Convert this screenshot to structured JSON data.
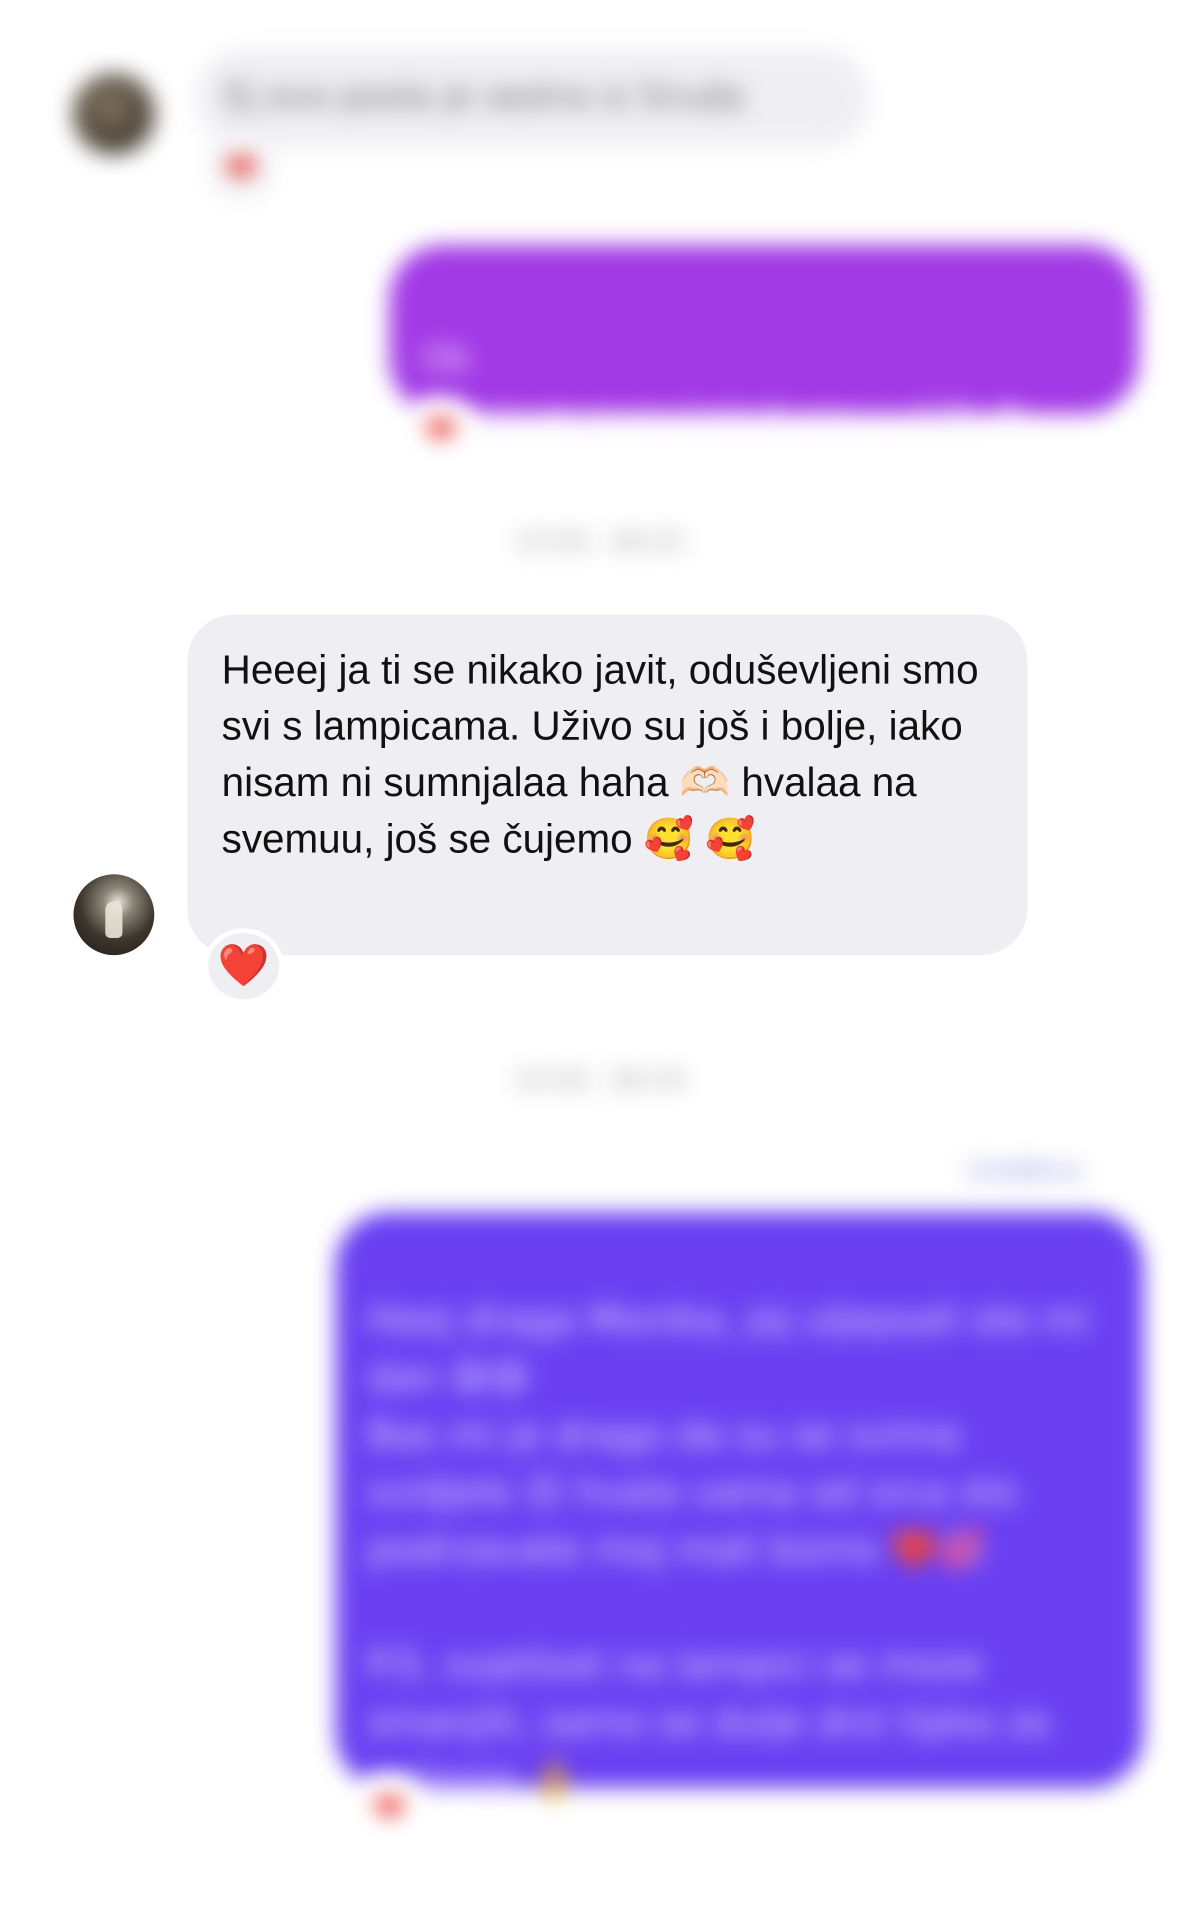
{
  "thread": {
    "messages": [
      {
        "direction": "incoming",
        "text": "Ej evo posla je sestra iz Gruda",
        "reaction": "❤"
      },
      {
        "direction": "outgoing",
        "text": "Ok\nBit ce muz na kolodvoru u 17h ❤",
        "reaction": "❤"
      },
      {
        "direction": "timestamp",
        "text": "13.01. 16:21"
      },
      {
        "direction": "incoming",
        "text": "Heeej ja ti se nikako javit, oduševljeni smo svi s lampicama. Uživo su još i bolje, iako nisam ni sumnjalaa haha 🫶🏻  hvalaa na svemuu, još se čujemo 🥰 🥰",
        "reaction": "❤️"
      },
      {
        "direction": "timestamp",
        "text": "13.01. 16:14"
      },
      {
        "direction": "read-receipt",
        "text": "Uređeno"
      },
      {
        "direction": "outgoing",
        "text": "Heej draga Monika, joj uljepsali ste mi dan 😄😄\nBas mi je drago da su se svima svidjele 😊 hvala vama od srca sto podrzavate moj mali biznis ❤️💞\n\nP.S. svjetlost na lampici se moze smanjiti, samo se dulje drzi tipka za paljenje 👌",
        "reaction": "❤"
      }
    ]
  },
  "colors": {
    "incoming_bubble": "#eeeef3",
    "outgoing_bubble_1": "#a23ae6",
    "outgoing_bubble_2": "#6a40f2",
    "reaction_heart": "#e5211c"
  }
}
